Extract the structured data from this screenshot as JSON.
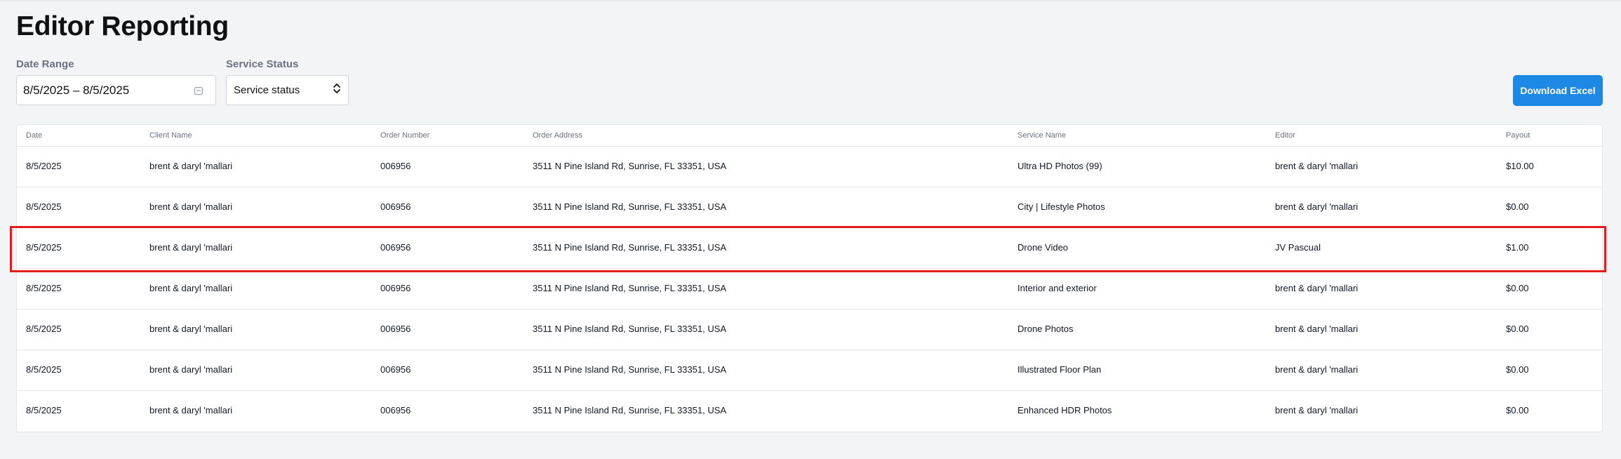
{
  "page": {
    "title": "Editor Reporting"
  },
  "filters": {
    "date_range": {
      "label": "Date Range",
      "value": "8/5/2025 – 8/5/2025"
    },
    "service_status": {
      "label": "Service Status",
      "value": "Service status"
    }
  },
  "actions": {
    "download_label": "Download Excel"
  },
  "table": {
    "columns": [
      "Date",
      "Client Name",
      "Order Number",
      "Order Address",
      "Service Name",
      "Editor",
      "Payout"
    ],
    "rows": [
      [
        "8/5/2025",
        "brent & daryl 'mallari",
        "006956",
        "3511 N Pine Island Rd, Sunrise, FL 33351, USA",
        "Ultra HD Photos (99)",
        "brent & daryl 'mallari",
        "$10.00"
      ],
      [
        "8/5/2025",
        "brent & daryl 'mallari",
        "006956",
        "3511 N Pine Island Rd, Sunrise, FL 33351, USA",
        "City | Lifestyle Photos",
        "brent & daryl 'mallari",
        "$0.00"
      ],
      [
        "8/5/2025",
        "brent & daryl 'mallari",
        "006956",
        "3511 N Pine Island Rd, Sunrise, FL 33351, USA",
        "Drone Video",
        "JV Pascual",
        "$1.00"
      ],
      [
        "8/5/2025",
        "brent & daryl 'mallari",
        "006956",
        "3511 N Pine Island Rd, Sunrise, FL 33351, USA",
        "Interior and exterior",
        "brent & daryl 'mallari",
        "$0.00"
      ],
      [
        "8/5/2025",
        "brent & daryl 'mallari",
        "006956",
        "3511 N Pine Island Rd, Sunrise, FL 33351, USA",
        "Drone Photos",
        "brent & daryl 'mallari",
        "$0.00"
      ],
      [
        "8/5/2025",
        "brent & daryl 'mallari",
        "006956",
        "3511 N Pine Island Rd, Sunrise, FL 33351, USA",
        "Illustrated Floor Plan",
        "brent & daryl 'mallari",
        "$0.00"
      ],
      [
        "8/5/2025",
        "brent & daryl 'mallari",
        "006956",
        "3511 N Pine Island Rd, Sunrise, FL 33351, USA",
        "Enhanced HDR Photos",
        "brent & daryl 'mallari",
        "$0.00"
      ]
    ],
    "highlighted_row": 2
  },
  "icons": {
    "date_input": "calendar-icon",
    "status_select": "up-down-chevron-icon"
  },
  "colors": {
    "accent": "#1e88e5",
    "highlight": "#e11d1d",
    "background": "#f3f4f6"
  }
}
